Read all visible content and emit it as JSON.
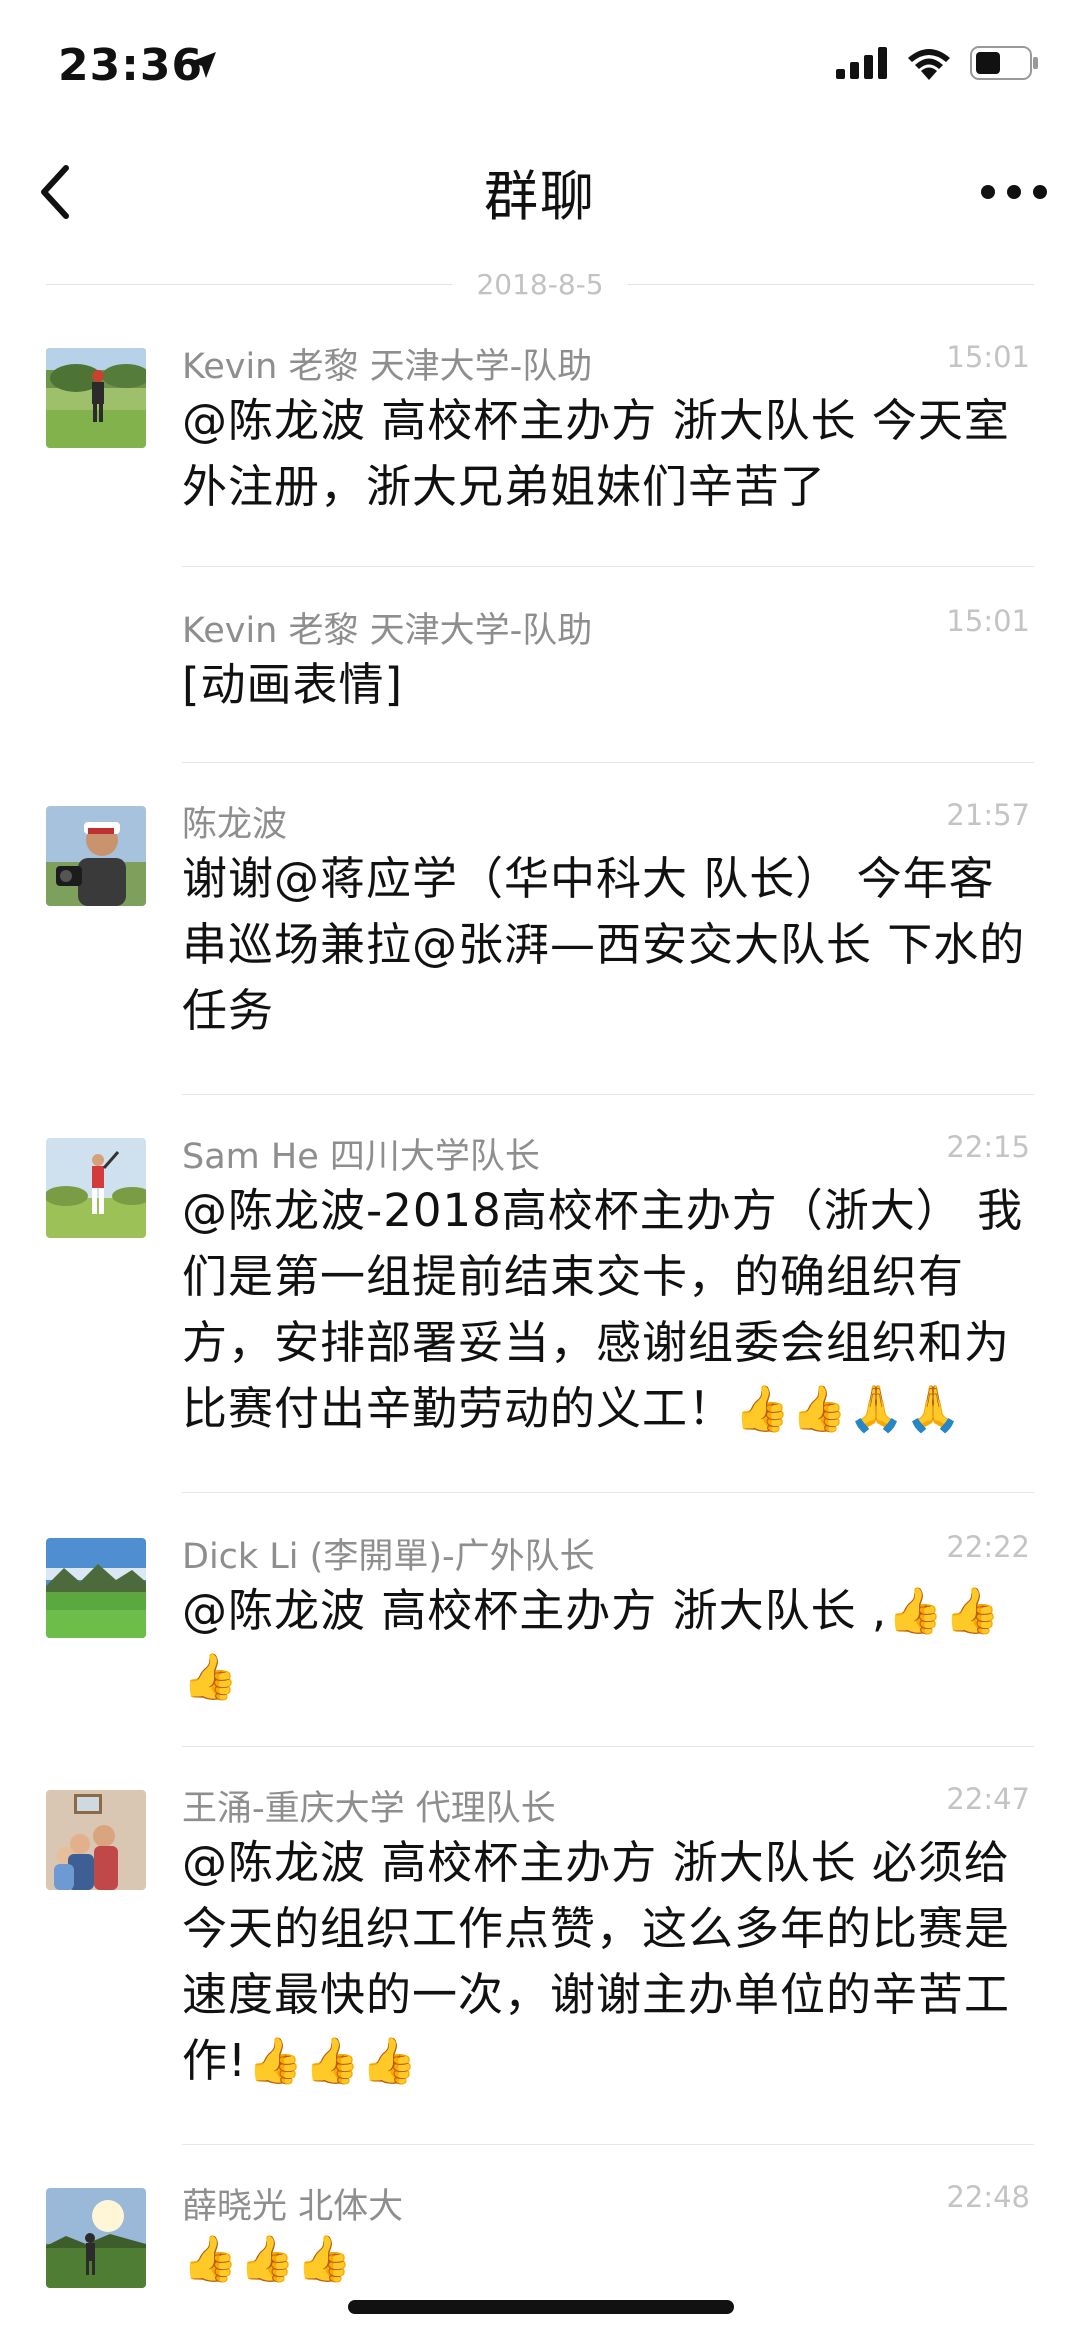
{
  "status": {
    "time": "23:36"
  },
  "nav": {
    "title": "群聊"
  },
  "date": "2018-8-5",
  "messages": [
    {
      "sender": "Kevin 老黎 天津大学-队助",
      "time": "15:01",
      "text": "@陈龙波 高校杯主办方 浙大队长 今天室外注册，浙大兄弟姐妹们辛苦了",
      "avatar": "golfer-green"
    },
    {
      "sender": "Kevin 老黎 天津大学-队助",
      "time": "15:01",
      "text": "[动画表情]",
      "avatar": ""
    },
    {
      "sender": "陈龙波",
      "time": "21:57",
      "text": "谢谢@蒋应学（华中科大 队长） 今年客串巡场兼拉@张湃—西安交大队长 下水的任务",
      "avatar": "man-cap"
    },
    {
      "sender": "Sam He 四川大学队长",
      "time": "22:15",
      "text": "@陈龙波-2018高校杯主办方（浙大） 我们是第一组提前结束交卡，的确组织有方，安排部署妥当，感谢组委会组织和为比赛付出辛勤劳动的义工！👍👍🙏🙏",
      "avatar": "golfer-red"
    },
    {
      "sender": "Dick Li (李開單)-广外队长",
      "time": "22:22",
      "text": "@陈龙波 高校杯主办方 浙大队长 ,👍👍👍",
      "avatar": "golf-course"
    },
    {
      "sender": "王涌-重庆大学 代理队长",
      "time": "22:47",
      "text": "@陈龙波 高校杯主办方 浙大队长 必须给今天的组织工作点赞，这么多年的比赛是速度最快的一次，谢谢主办单位的辛苦工作!👍👍👍",
      "avatar": "family"
    },
    {
      "sender": "薛晓光 北体大",
      "time": "22:48",
      "text": "👍👍👍",
      "avatar": "golfer-sunset"
    }
  ]
}
